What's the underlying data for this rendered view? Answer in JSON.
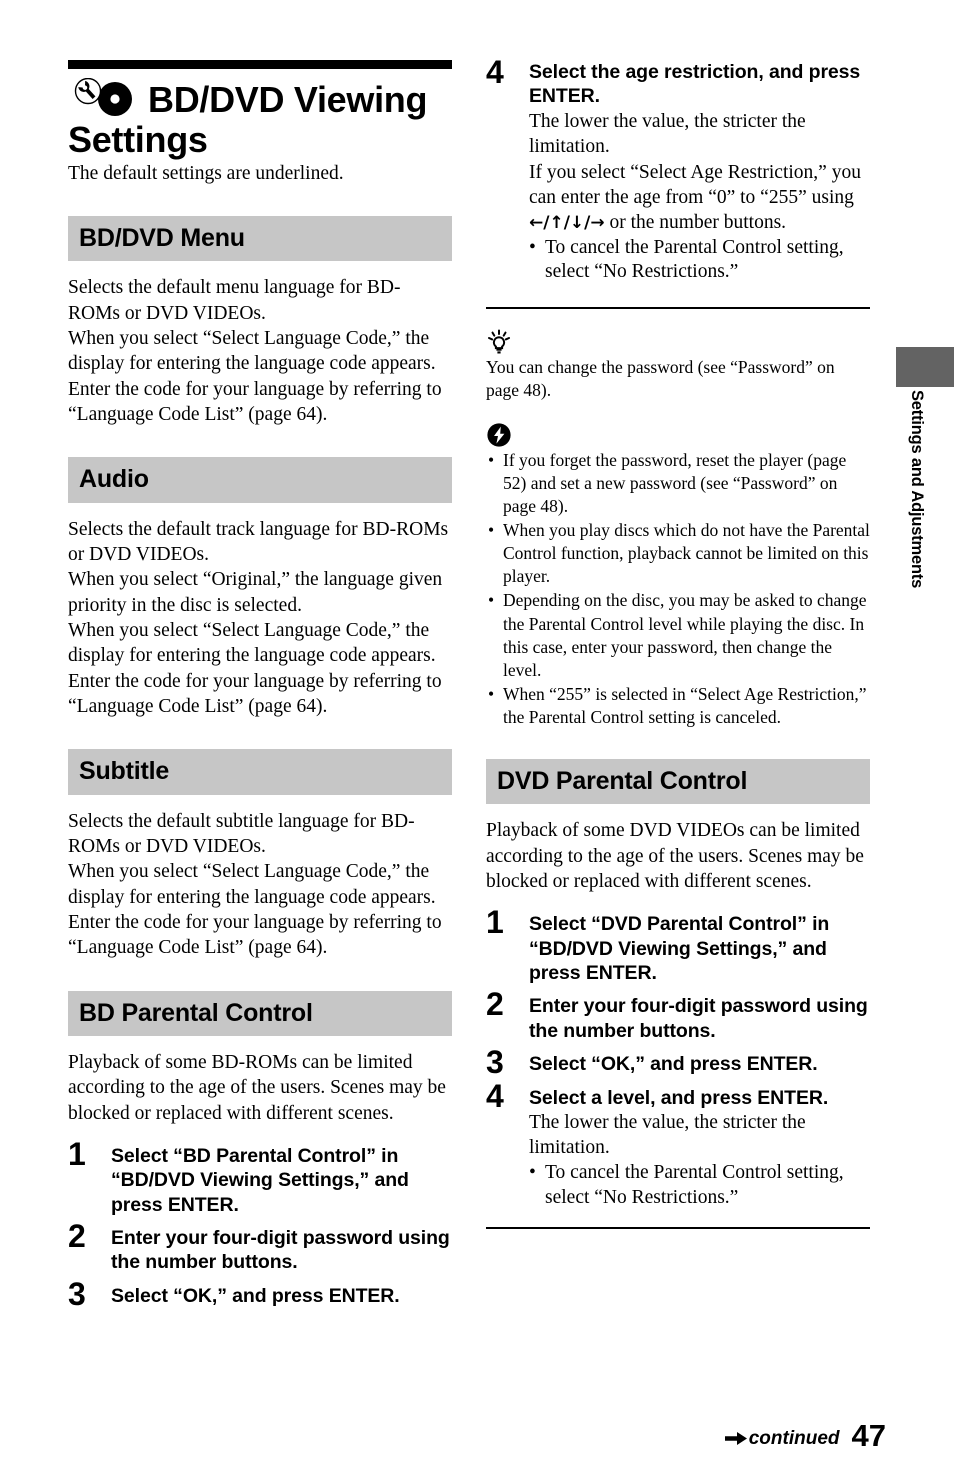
{
  "page": {
    "number": "47",
    "continued_label": "continued",
    "side_tab": "Settings and Adjustments"
  },
  "title": {
    "text": "BD/DVD Viewing Settings",
    "icon": "wrench-disc-icon"
  },
  "intro": "The default settings are underlined.",
  "left_column": {
    "sections": [
      {
        "heading": "BD/DVD Menu",
        "body": "Selects the default menu language for BD-ROMs or DVD VIDEOs.\nWhen you select “Select Language Code,” the display for entering the language code appears. Enter the code for your language by referring to “Language Code List” (page 64)."
      },
      {
        "heading": "Audio",
        "body": "Selects the default track language for BD-ROMs or DVD VIDEOs.\nWhen you select “Original,” the language given priority in the disc is selected.\nWhen you select “Select Language Code,” the display for entering the language code appears. Enter the code for your language by referring to “Language Code List” (page 64)."
      },
      {
        "heading": "Subtitle",
        "body": "Selects the default subtitle language for BD-ROMs or DVD VIDEOs.\nWhen you select “Select Language Code,” the display for entering the language code appears. Enter the code for your language by referring to “Language Code List” (page 64)."
      },
      {
        "heading": "BD Parental Control",
        "body": "Playback of some BD-ROMs can be limited according to the age of the users. Scenes may be blocked or replaced with different scenes."
      }
    ],
    "steps": [
      {
        "num": "1",
        "title": "Select “BD Parental Control” in “BD/DVD Viewing Settings,” and press ENTER."
      },
      {
        "num": "2",
        "title": "Enter your four-digit password using the number buttons."
      },
      {
        "num": "3",
        "title": "Select “OK,” and press ENTER."
      }
    ]
  },
  "right_column": {
    "step4_bd": {
      "num": "4",
      "title": "Select the age restriction, and press ENTER.",
      "body_1": "The lower the value, the stricter the limitation.",
      "body_2_pre": "If you select “Select Age Restriction,” you can enter the age from “0” to “255” using ",
      "body_2_arrows": "←/↑/↓/→",
      "body_2_post": " or the number buttons.",
      "bullets": [
        "To cancel the Parental Control setting, select “No Restrictions.”"
      ]
    },
    "tip": {
      "icon": "lightbulb-tip-icon",
      "text": "You can change the password (see “Password” on page 48)."
    },
    "note": {
      "icon": "lightning-note-icon",
      "items": [
        "If you forget the password, reset the player (page 52) and set a new password (see “Password” on page 48).",
        "When you play discs which do not have the Parental Control function, playback cannot be limited on this player.",
        "Depending on the disc, you may be asked to change the Parental Control level while playing the disc. In this case, enter your password, then change the level.",
        "When “255” is selected in “Select Age Restriction,” the Parental Control setting is canceled."
      ]
    },
    "dvd_section": {
      "heading": "DVD Parental Control",
      "body": "Playback of some DVD VIDEOs can be limited according to the age of the users. Scenes may be blocked or replaced with different scenes."
    },
    "dvd_steps": [
      {
        "num": "1",
        "title": "Select “DVD Parental Control” in “BD/DVD Viewing Settings,” and press ENTER."
      },
      {
        "num": "2",
        "title": "Enter your four-digit password using the number buttons."
      },
      {
        "num": "3",
        "title": "Select “OK,” and press ENTER."
      },
      {
        "num": "4",
        "title": "Select a level, and press ENTER."
      }
    ],
    "step4_dvd_body": "The lower the value, the stricter the limitation.",
    "step4_dvd_bullets": [
      "To cancel the Parental Control setting, select “No Restrictions.”"
    ]
  },
  "colors": {
    "heading_bg": "#c6c6c6",
    "side_tab_bg": "#636363",
    "text": "#000000"
  }
}
